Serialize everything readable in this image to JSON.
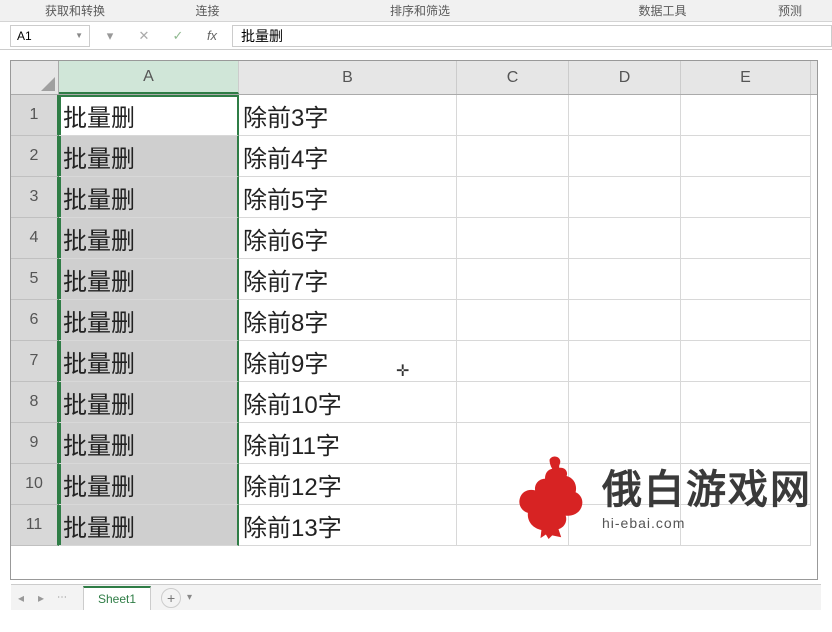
{
  "ribbon_groups": {
    "g1": "获取和转换",
    "g2": "连接",
    "g3": "排序和筛选",
    "g4": "数据工具",
    "g5": "预测"
  },
  "name_box": "A1",
  "formula_value": "批量删",
  "columns": [
    "A",
    "B",
    "C",
    "D",
    "E"
  ],
  "rows": [
    {
      "n": "1",
      "a": "批量删",
      "b": "除前3字"
    },
    {
      "n": "2",
      "a": "批量删",
      "b": "除前4字"
    },
    {
      "n": "3",
      "a": "批量删",
      "b": "除前5字"
    },
    {
      "n": "4",
      "a": "批量删",
      "b": "除前6字"
    },
    {
      "n": "5",
      "a": "批量删",
      "b": "除前7字"
    },
    {
      "n": "6",
      "a": "批量删",
      "b": "除前8字"
    },
    {
      "n": "7",
      "a": "批量删",
      "b": "除前9字"
    },
    {
      "n": "8",
      "a": "批量删",
      "b": "除前10字"
    },
    {
      "n": "9",
      "a": "批量删",
      "b": "除前11字"
    },
    {
      "n": "10",
      "a": "批量删",
      "b": "除前12字"
    },
    {
      "n": "11",
      "a": "批量删",
      "b": "除前13字"
    }
  ],
  "sheet_tab": "Sheet1",
  "watermark": {
    "title": "俄白游戏网",
    "sub": "hi-ebai.com"
  }
}
